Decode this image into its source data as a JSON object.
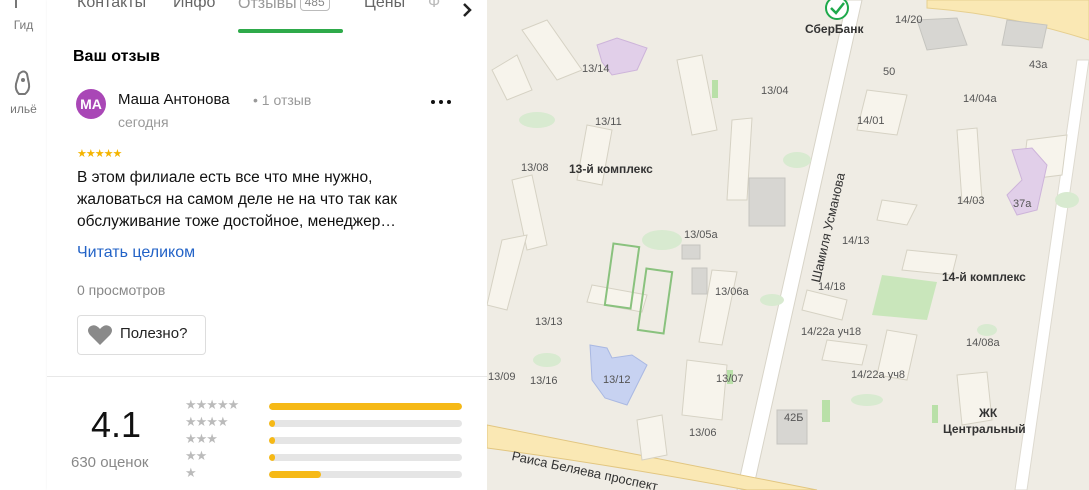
{
  "rail": {
    "items": [
      {
        "label": "Гид",
        "icon": "guide-icon"
      },
      {
        "label": "ильё",
        "icon": "housing-icon"
      }
    ]
  },
  "tabs": {
    "items": [
      {
        "label": "Контакты"
      },
      {
        "label": "Инфо"
      },
      {
        "label": "Отзывы",
        "badge": "485",
        "active": true
      },
      {
        "label": "Цены"
      },
      {
        "label": "Ф"
      }
    ],
    "next_icon": "chevron-right-icon"
  },
  "review": {
    "section_title": "Ваш отзыв",
    "avatar_initials": "МА",
    "author": "Маша Антонова",
    "author_meta": "• 1 отзыв",
    "date": "сегодня",
    "stars": 5,
    "text": "В этом филиале есть все что мне нужно, жаловаться на самом деле не на что так как обслуживание тоже достойное, менеджер…",
    "read_more": "Читать целиком",
    "views": "0 просмотров",
    "helpful_label": "Полезно?",
    "more_icon": "more-dots-icon"
  },
  "rating": {
    "value": "4.1",
    "count_label": "630 оценок",
    "breakdown": [
      {
        "stars": 5,
        "fraction": 1.0
      },
      {
        "stars": 4,
        "fraction": 0.03
      },
      {
        "stars": 3,
        "fraction": 0.03
      },
      {
        "stars": 2,
        "fraction": 0.03
      },
      {
        "stars": 1,
        "fraction": 0.27
      }
    ]
  },
  "map": {
    "poi": "СберБанк",
    "districts": [
      "13-й комплекс",
      "14-й комплекс"
    ],
    "complex_label": [
      "ЖК",
      "Центральный"
    ],
    "streets": [
      "Шамиля Усманова",
      "Раиса Беляева проспект"
    ],
    "buildings": [
      "14/20",
      "13/14",
      "50",
      "43а",
      "13/04",
      "14/04а",
      "13/11",
      "14/01",
      "13/08",
      "14/03",
      "37а",
      "13/05а",
      "14/13",
      "13/06а",
      "14/18",
      "13/13",
      "14/22а уч18",
      "14/08а",
      "13/09",
      "13/16",
      "13/12",
      "13/07",
      "14/22а уч8",
      "42Б",
      "13/06"
    ]
  }
}
